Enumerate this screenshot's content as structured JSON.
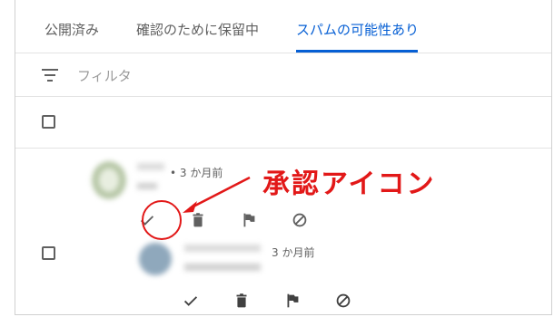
{
  "tabs": [
    {
      "label": "公開済み",
      "active": false
    },
    {
      "label": "確認のために保留中",
      "active": false
    },
    {
      "label": "スパムの可能性あり",
      "active": true
    }
  ],
  "filter": {
    "placeholder": "フィルタ",
    "icon": "filter-icon"
  },
  "comments": [
    {
      "time": "• 3 か月前"
    },
    {
      "time": "3 か月前"
    }
  ],
  "actions": [
    "approve-check-icon",
    "delete-trash-icon",
    "report-flag-icon",
    "block-icon"
  ],
  "annotation": {
    "label": "承認アイコン",
    "color": "#e21818"
  },
  "colors": {
    "accent": "#065fd4",
    "icon": "#606060"
  }
}
